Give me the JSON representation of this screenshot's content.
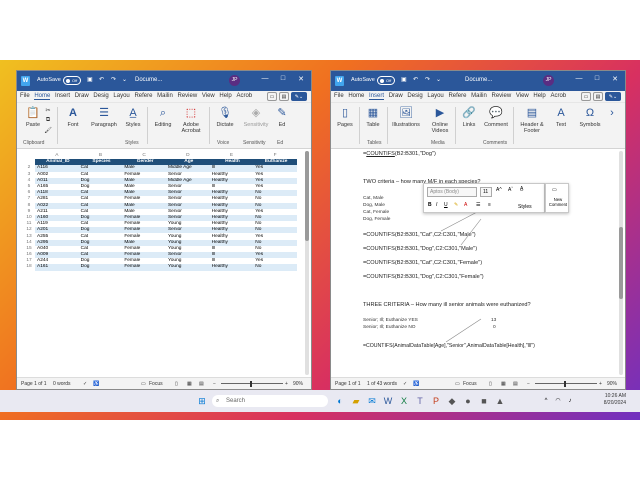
{
  "left_window": {
    "autosave": "AutoSave",
    "toggle": "Off",
    "title": "Docume...",
    "avatar": "JP",
    "menu": [
      "File",
      "Home",
      "Insert",
      "Draw",
      "Desig",
      "Layou",
      "Refere",
      "Mailin",
      "Review",
      "View",
      "Help",
      "Acrob"
    ],
    "ribbon": {
      "paste": "Paste",
      "font": "Font",
      "paragraph": "Paragraph",
      "styles": "Styles",
      "editing": "Editing",
      "adobe": "Adobe Acrobat",
      "dictate": "Dictate",
      "sensitivity": "Sensitivity",
      "editor": "Ed",
      "groups": [
        "Clipboard",
        "Styles",
        "Voice",
        "Sensitivity",
        "Ed"
      ]
    },
    "sheet": {
      "col_letters": [
        "A",
        "B",
        "C",
        "D",
        "E",
        "F"
      ],
      "headers": [
        "Animal_ID",
        "Species",
        "Gender",
        "Age",
        "Health",
        "Euthanize"
      ],
      "rows": [
        [
          "A116",
          "Cat",
          "Male",
          "Middle Age",
          "Ill",
          "Yes"
        ],
        [
          "A002",
          "Cat",
          "Female",
          "Senior",
          "Healthy",
          "Yes"
        ],
        [
          "A011",
          "Dog",
          "Male",
          "Middle Age",
          "Healthy",
          "Yes"
        ],
        [
          "A165",
          "Dog",
          "Male",
          "Senior",
          "Ill",
          "Yes"
        ],
        [
          "A118",
          "Cat",
          "Male",
          "Senior",
          "Healthy",
          "No"
        ],
        [
          "A281",
          "Cat",
          "Female",
          "Senior",
          "Healthy",
          "No"
        ],
        [
          "A022",
          "Cat",
          "Male",
          "Senior",
          "Healthy",
          "No"
        ],
        [
          "A211",
          "Cat",
          "Male",
          "Senior",
          "Healthy",
          "Yes"
        ],
        [
          "A160",
          "Dog",
          "Female",
          "Senior",
          "Healthy",
          "No"
        ],
        [
          "A119",
          "Cat",
          "Female",
          "Young",
          "Healthy",
          "No"
        ],
        [
          "A201",
          "Dog",
          "Female",
          "Senior",
          "Healthy",
          "No"
        ],
        [
          "A255",
          "Cat",
          "Female",
          "Young",
          "Healthy",
          "Yes"
        ],
        [
          "A295",
          "Dog",
          "Male",
          "Young",
          "Healthy",
          "No"
        ],
        [
          "A040",
          "Cat",
          "Female",
          "Young",
          "Ill",
          "No"
        ],
        [
          "A009",
          "Cat",
          "Female",
          "Senior",
          "Ill",
          "Yes"
        ],
        [
          "A244",
          "Dog",
          "Female",
          "Young",
          "Ill",
          "Yes"
        ],
        [
          "A161",
          "Dog",
          "Female",
          "Young",
          "Healthy",
          "No"
        ]
      ]
    },
    "status": {
      "page": "Page 1 of 1",
      "words": "0 words",
      "focus": "Focus",
      "zoom": "90%"
    }
  },
  "right_window": {
    "autosave": "AutoSave",
    "toggle": "Off",
    "title": "Docume...",
    "avatar": "JP",
    "menu": [
      "File",
      "Home",
      "Insert",
      "Draw",
      "Desig",
      "Layou",
      "Refere",
      "Mailin",
      "Review",
      "View",
      "Help",
      "Acrob"
    ],
    "ribbon": {
      "pages": "Pages",
      "table": "Table",
      "illustrations": "Illustrations",
      "online_videos": "Online Videos",
      "links": "Links",
      "comment": "Comment",
      "header_footer": "Header & Footer",
      "text": "Text",
      "symbols": "Symbols",
      "groups": [
        "Tables",
        "Media",
        "Comments"
      ]
    },
    "doc": {
      "line1_prefix": "=",
      "line1_fn": "COUNTIFS",
      "line1_rest": "(B2:B301,\"Dog\")",
      "two_criteria": "TWO criteria – how many M/F in each species?",
      "labels_two": [
        "Cat, Male",
        "Dog, Male",
        "Cat, Female",
        "Dog, Female"
      ],
      "floatbar": {
        "font": "Aptos (Body)",
        "size": "11",
        "styles": "Styles",
        "new_comment": "New Comment"
      },
      "f_cat_male": "=COUNTIFS(B2:B301,\"Cat\",C2:C301,\"Male\")",
      "f_dog_male": "=COUNTIFS(B2:B301,\"Dog\",C2:C301,\"Male\")",
      "f_cat_female": "=COUNTIFS(B2:B301,\"Cat\",C2:C301,\"Female\")",
      "f_dog_female": "=COUNTIFS(B2:B301,\"Dog\",C2:C301,\"Female\")",
      "three_criteria": "THREE CRITERIA – How many ill senior animals were euthanized?",
      "labels_three": [
        "Senior; Ill; Euthanize YES",
        "Senior; Ill; Euthanize NO"
      ],
      "values_three": [
        "13",
        "0"
      ],
      "f_three": "=COUNTIFS(AnimalDataTable[Age],\"Senior\",AnimalDataTable[Health],\"Ill\")"
    },
    "status": {
      "page": "Page 1 of 1",
      "words": "1 of 43 words",
      "focus": "Focus",
      "zoom": "90%"
    }
  },
  "taskbar": {
    "search": "Search",
    "time": "10:26 AM",
    "date": "8/20/2024"
  }
}
